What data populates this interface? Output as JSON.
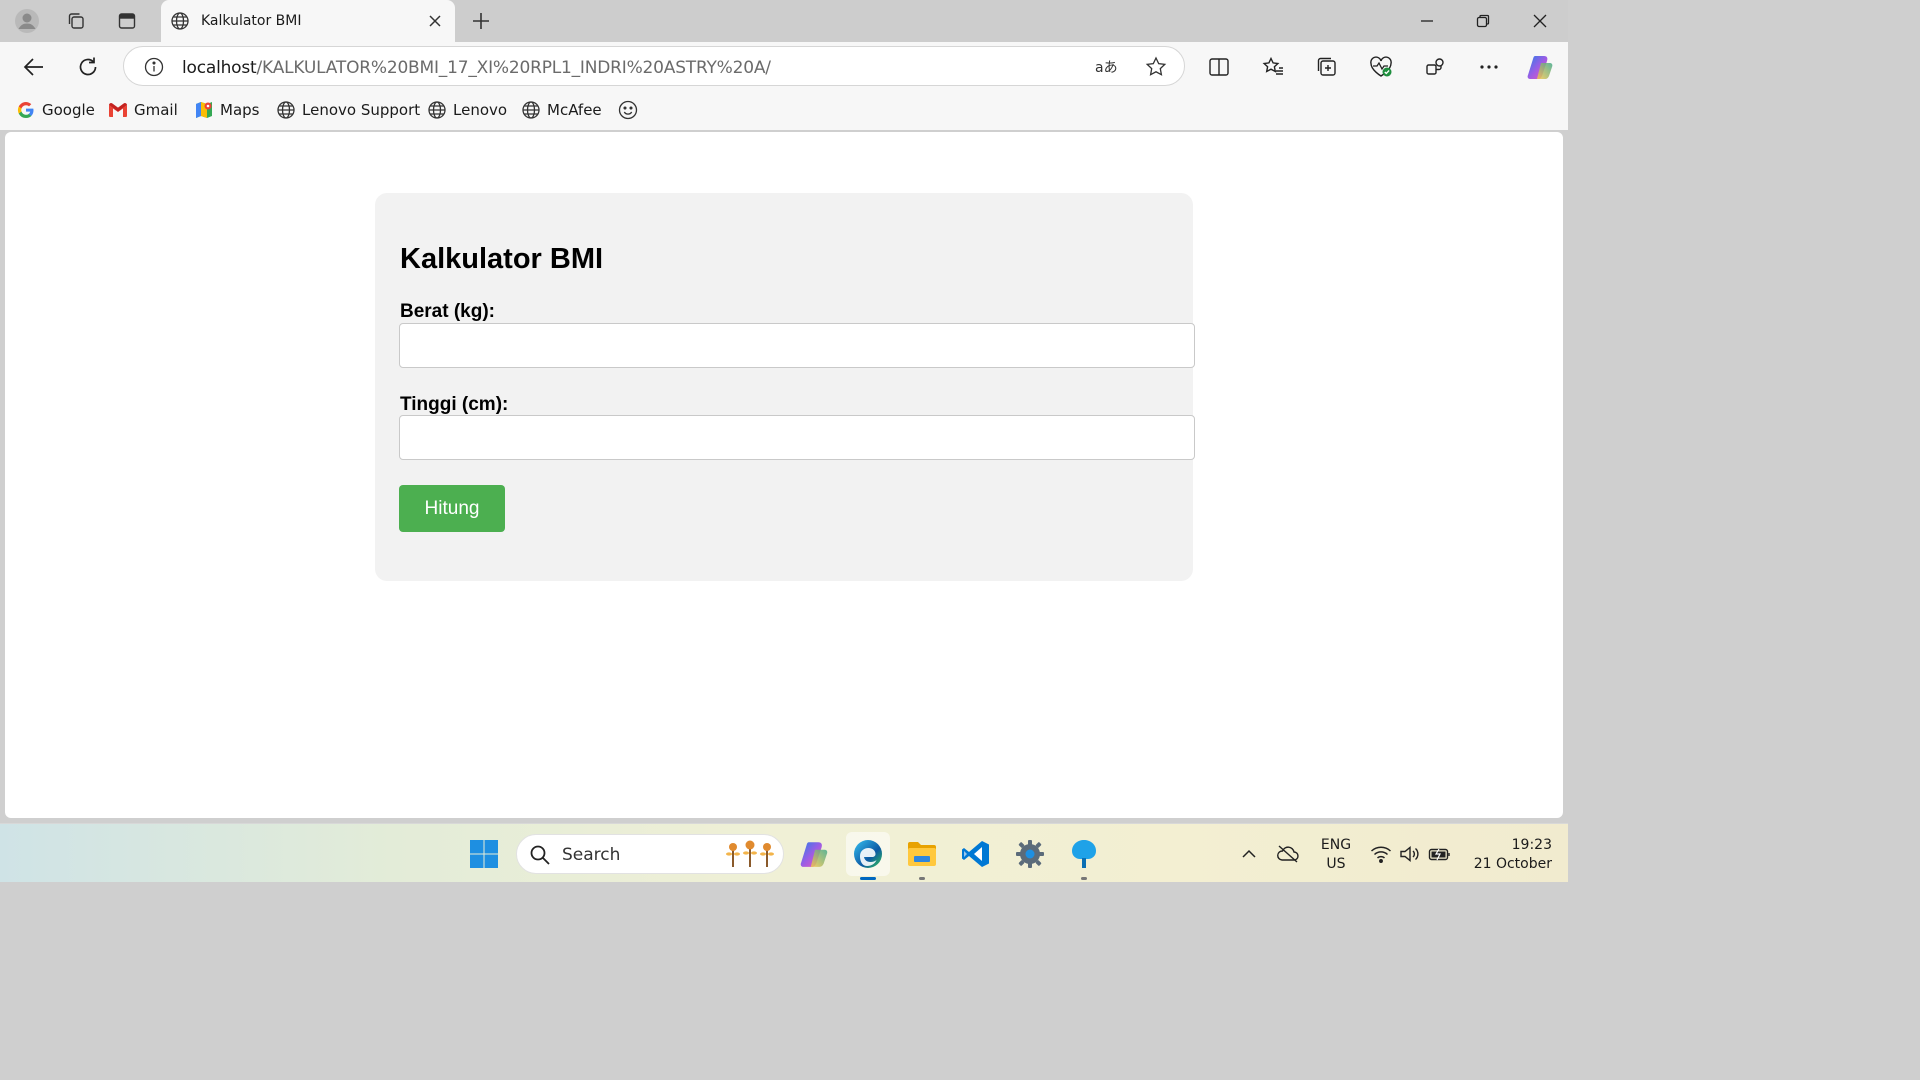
{
  "browser": {
    "tab": {
      "title": "Kalkulator BMI",
      "icon": "globe-icon"
    },
    "address": {
      "host": "localhost",
      "path": "/KALKULATOR%20BMI_17_XI%20RPL1_INDRI%20ASTRY%20A/"
    },
    "favorites": [
      {
        "label": "Google",
        "icon": "google-icon"
      },
      {
        "label": "Gmail",
        "icon": "gmail-icon"
      },
      {
        "label": "Maps",
        "icon": "maps-icon"
      },
      {
        "label": "Lenovo Support",
        "icon": "globe-icon"
      },
      {
        "label": "Lenovo",
        "icon": "globe-icon"
      },
      {
        "label": "McAfee",
        "icon": "globe-icon"
      }
    ]
  },
  "page": {
    "title": "Kalkulator BMI",
    "weight_label": "Berat (kg):",
    "weight_value": "",
    "height_label": "Tinggi (cm):",
    "height_value": "",
    "submit_label": "Hitung",
    "button_color": "#4caf50"
  },
  "taskbar": {
    "search_placeholder": "Search",
    "language": {
      "line1": "ENG",
      "line2": "US"
    },
    "clock": {
      "time": "19:23",
      "date": "21 October"
    }
  }
}
